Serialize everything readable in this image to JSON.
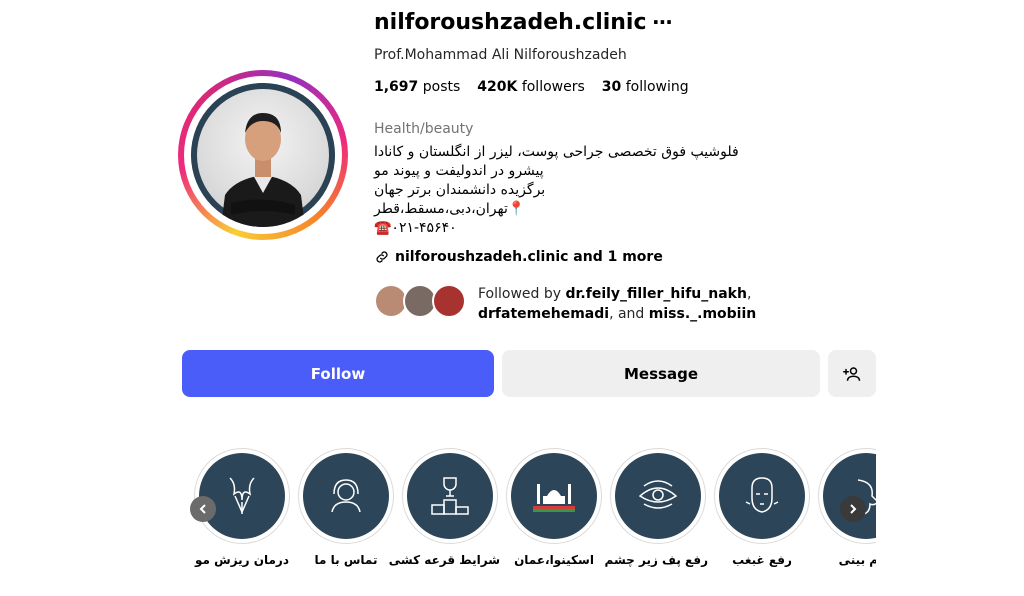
{
  "profile": {
    "username": "nilforoushzadeh.clinic",
    "full_name": "Prof.Mohammad Ali Nilforoushzadeh",
    "stats": {
      "posts_count": "1,697",
      "posts_label": "posts",
      "followers_count": "420K",
      "followers_label": "followers",
      "following_count": "30",
      "following_label": "following"
    },
    "category": "Health/beauty",
    "bio_lines": [
      "فلوشیپ فوق تخصصی جراحی پوست، لیزر از انگلستان و کانادا",
      "پیشرو در اندولیفت و پیوند مو",
      "برگزیده دانشمندان برتر جهان",
      "📍تهران،دبی،مسقط،قطر",
      "☎️۰۲۱-۴۵۶۴۰"
    ],
    "link_text": "nilforoushzadeh.clinic and 1 more",
    "followed_by": {
      "prefix": "Followed by",
      "user1": "dr.feily_filler_hifu_nakh",
      "sep": ",",
      "user2": "drfatemehemadi",
      "and": ", and",
      "user3": "miss._.mobiin"
    }
  },
  "actions": {
    "follow_label": "Follow",
    "message_label": "Message",
    "add_user_icon": "person-add-icon"
  },
  "highlights": [
    {
      "label": "درمان ریزش مو",
      "icon": "hair-icon"
    },
    {
      "label": "تماس با ما",
      "icon": "support-agent-icon"
    },
    {
      "label": "شرایط قرعه کشی",
      "icon": "podium-icon"
    },
    {
      "label": "اسکینوا،عمان",
      "icon": "mosque-icon"
    },
    {
      "label": "رفع پف زیر چشم",
      "icon": "eye-icon"
    },
    {
      "label": "رفع غبغب",
      "icon": "face-icon"
    },
    {
      "label": "فرم بینی",
      "icon": "nose-icon"
    }
  ],
  "colors": {
    "follow_bg": "#4a5df9",
    "secondary_bg": "#efefef",
    "highlight_bg": "#2d4558"
  }
}
